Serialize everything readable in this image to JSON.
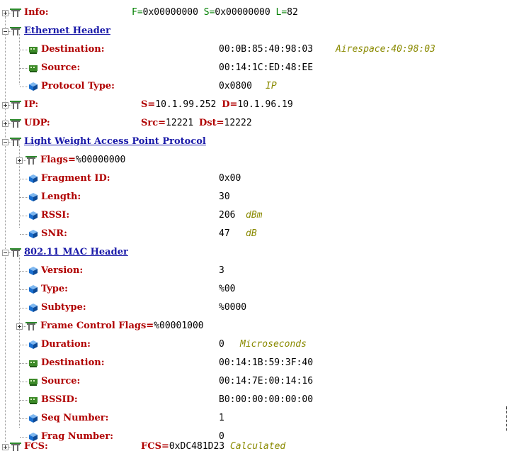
{
  "rows": [
    {
      "label": "Info:",
      "parts": [
        {
          "t": "F=",
          "c": "grn"
        },
        {
          "t": "0x00000000 ",
          "c": "val"
        },
        {
          "t": "S=",
          "c": "grn"
        },
        {
          "t": "0x00000000 ",
          "c": "val"
        },
        {
          "t": "L=",
          "c": "grn"
        },
        {
          "t": "82",
          "c": "val"
        }
      ]
    },
    {
      "label": "Ethernet Header"
    },
    {
      "label": "Destination:",
      "value": "00:0B:85:40:98:03",
      "unit": "Airespace:40:98:03"
    },
    {
      "label": "Source:",
      "value": "00:14:1C:ED:48:EE"
    },
    {
      "label": "Protocol Type:",
      "value": "0x0800",
      "unit": "IP"
    },
    {
      "label": "IP:",
      "parts": [
        {
          "t": "S=",
          "c": "red"
        },
        {
          "t": "10.1.99.252 ",
          "c": "val"
        },
        {
          "t": "D=",
          "c": "red"
        },
        {
          "t": "10.1.96.19",
          "c": "val"
        }
      ]
    },
    {
      "label": "UDP:",
      "parts": [
        {
          "t": "Src=",
          "c": "red"
        },
        {
          "t": "12221 ",
          "c": "val"
        },
        {
          "t": "Dst=",
          "c": "red"
        },
        {
          "t": "12222",
          "c": "val"
        }
      ]
    },
    {
      "label": "Light Weight Access Point Protocol"
    },
    {
      "label": "Flags=",
      "suffix": "%00000000"
    },
    {
      "label": "Fragment ID:",
      "value": "0x00"
    },
    {
      "label": "Length:",
      "value": "30"
    },
    {
      "label": "RSSI:",
      "value": "206",
      "unit": "dBm"
    },
    {
      "label": "SNR:",
      "value": "47",
      "unit": "dB"
    },
    {
      "label": "802.11 MAC Header"
    },
    {
      "label": "Version:",
      "value": "3"
    },
    {
      "label": "Type:",
      "value": "%00"
    },
    {
      "label": "Subtype:",
      "value": "%0000"
    },
    {
      "label": "Frame Control Flags=",
      "suffix": "%00001000"
    },
    {
      "label": "Duration:",
      "value": "0",
      "unit": "Microseconds"
    },
    {
      "label": "Destination:",
      "value": "00:14:1B:59:3F:40"
    },
    {
      "label": "Source:",
      "value": "00:14:7E:00:14:16"
    },
    {
      "label": "BSSID:",
      "value": "B0:00:00:00:00:00"
    },
    {
      "label": "Seq Number:",
      "value": "1"
    },
    {
      "label": "Frag Number:",
      "value": "0"
    },
    {
      "label": "FCS:",
      "parts": [
        {
          "t": "FCS=",
          "c": "red"
        },
        {
          "t": "0xDC481D23 ",
          "c": "val"
        },
        {
          "t": "Calculated",
          "c": "unit"
        }
      ]
    }
  ],
  "figure_id": "220825",
  "icons": {
    "folder": "folder-icon",
    "device": "network-device-icon",
    "field": "field-cube-icon"
  },
  "colors": {
    "label": "#b00000",
    "header": "#1a1aa8",
    "equals": "#008000",
    "unit": "#8a8a00",
    "device": "#3c8a28",
    "field": "#1a6fd0"
  }
}
